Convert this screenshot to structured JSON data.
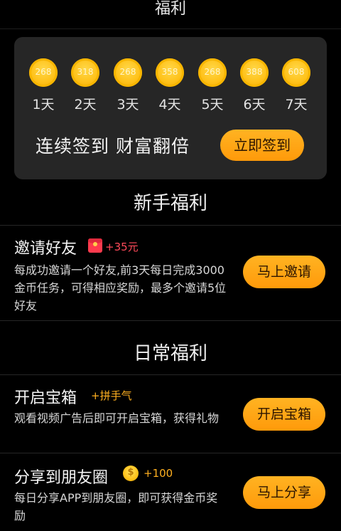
{
  "header": {
    "title": "福利"
  },
  "checkin": {
    "days": [
      {
        "coins": "268",
        "label": "1天"
      },
      {
        "coins": "318",
        "label": "2天"
      },
      {
        "coins": "268",
        "label": "3天"
      },
      {
        "coins": "358",
        "label": "4天"
      },
      {
        "coins": "268",
        "label": "5天"
      },
      {
        "coins": "388",
        "label": "6天"
      },
      {
        "coins": "608",
        "label": "7天"
      }
    ],
    "slogan": "连续签到 财富翻倍",
    "button_label": "立即签到"
  },
  "newbie": {
    "title": "新手福利",
    "tasks": [
      {
        "title": "邀请好友",
        "reward_icon": "red-packet-icon",
        "reward": "+35元",
        "description": "每成功邀请一个好友,前3天每日完成3000金币任务，可得相应奖励，最多个邀请5位好友",
        "button_label": "马上邀请"
      }
    ]
  },
  "daily": {
    "title": "日常福利",
    "tasks": [
      {
        "title": "开启宝箱",
        "reward": "+拼手气",
        "description": "观看视频广告后即可开启宝箱，获得礼物",
        "button_label": "开启宝箱"
      },
      {
        "title": "分享到朋友圈",
        "reward_icon": "gold-coin-icon",
        "reward": "+100",
        "description": "每日分享APP到朋友圈，即可获得金币奖励",
        "button_label": "马上分享"
      }
    ]
  },
  "colors": {
    "accent": "#ff9f12",
    "card_bg": "#262626",
    "reward_red": "#ff4a5a",
    "reward_gold": "#ffb020"
  }
}
